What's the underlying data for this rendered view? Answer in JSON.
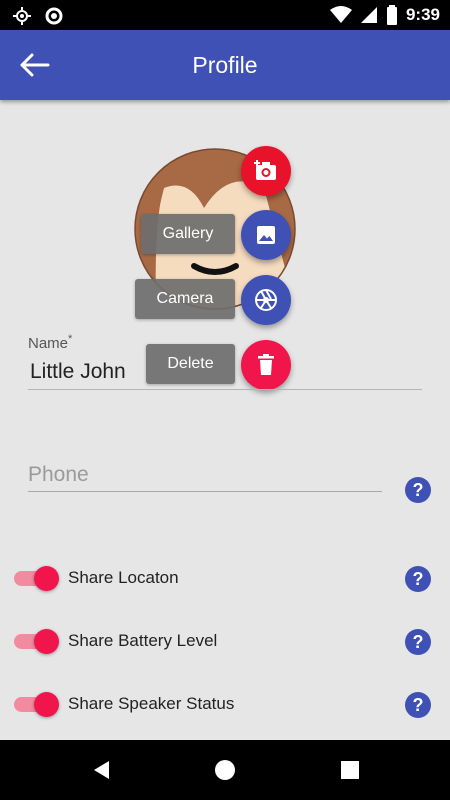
{
  "status_bar": {
    "time": "9:39",
    "icons": [
      "gps-icon",
      "circle-icon",
      "wifi-icon",
      "signal-icon",
      "battery-icon"
    ]
  },
  "app_bar": {
    "title": "Profile",
    "back_icon": "arrow-left-icon"
  },
  "fab_menu": {
    "main_icon": "add-photo-icon",
    "items": [
      {
        "label": "Gallery",
        "icon": "image-icon"
      },
      {
        "label": "Camera",
        "icon": "camera-shutter-icon"
      },
      {
        "label": "Delete",
        "icon": "trash-icon"
      }
    ]
  },
  "form": {
    "name_label": "Name",
    "name_required_marker": "*",
    "name_value": "Little John",
    "phone_placeholder": "Phone",
    "phone_value": ""
  },
  "toggles": [
    {
      "label": "Share Locaton",
      "on": true
    },
    {
      "label": "Share Battery Level",
      "on": true
    },
    {
      "label": "Share Speaker Status",
      "on": true
    }
  ],
  "help_glyph": "?",
  "colors": {
    "primary": "#3f51b5",
    "accent": "#f0164c",
    "background": "#e6e6e6"
  }
}
